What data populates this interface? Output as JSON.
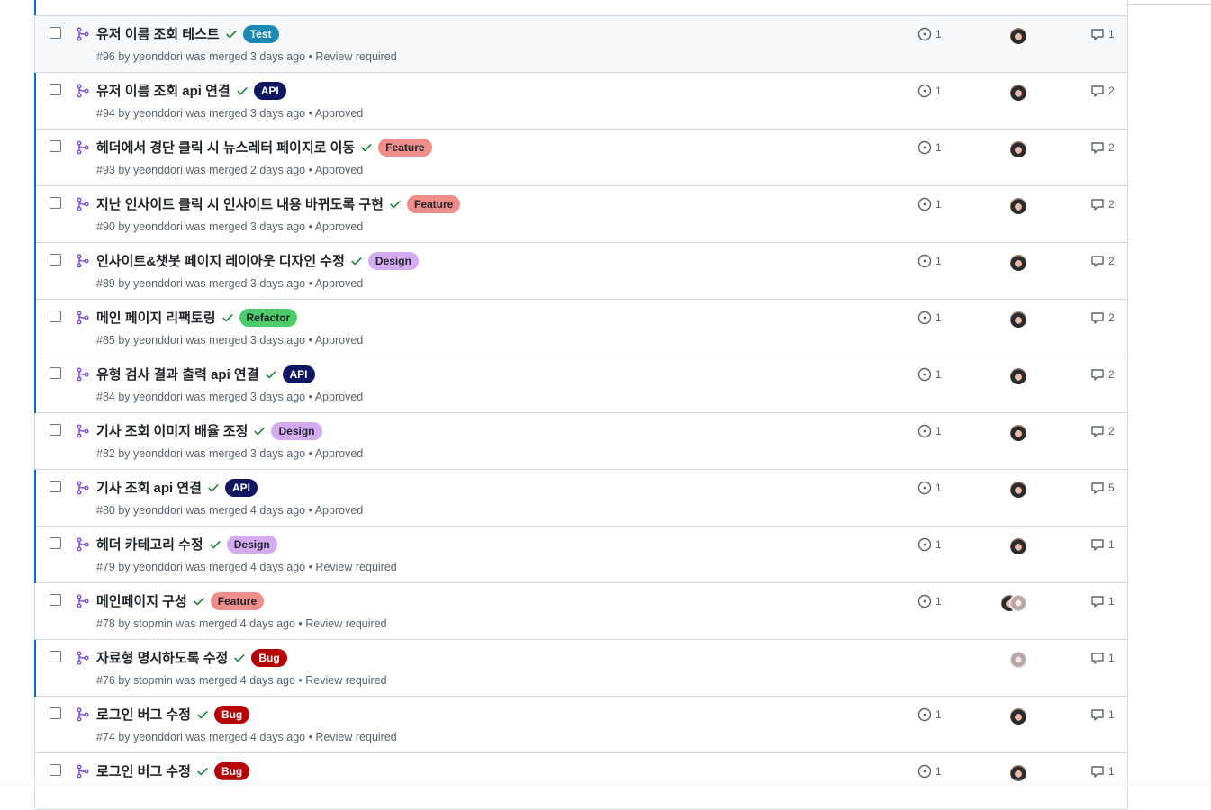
{
  "colors": {
    "merged_purple": "#8250df",
    "check_green": "#1a7f37",
    "unread_blue": "#0969da"
  },
  "icons": {
    "pr": "git-merge-icon",
    "status": "check-icon",
    "linked_issue": "issue-opened-icon",
    "comment": "comment-icon"
  },
  "pull_requests": [
    {
      "title": "유저 이름 조회 테스트",
      "label": "Test",
      "label_bg": "#1b8ab3",
      "label_fg": "#ffffff",
      "meta": "#96 by yeonddori was merged 3 days ago • Review required",
      "issues": "1",
      "comments": "1",
      "avatars": [
        "dark"
      ],
      "hover": true,
      "unread": false
    },
    {
      "title": "유저 이름 조회 api 연결",
      "label": "API",
      "label_bg": "#0e1561",
      "label_fg": "#ffffff",
      "meta": "#94 by yeonddori was merged 3 days ago • Approved",
      "issues": "1",
      "comments": "2",
      "avatars": [
        "dark"
      ],
      "hover": false,
      "unread": true
    },
    {
      "title": "헤더에서 경단 클릭 시 뉴스레터 페이지로 이동",
      "label": "Feature",
      "label_bg": "#ee8d8a",
      "label_fg": "#1f2328",
      "meta": "#93 by yeonddori was merged 2 days ago • Approved",
      "issues": "1",
      "comments": "2",
      "avatars": [
        "dark"
      ],
      "hover": false,
      "unread": true
    },
    {
      "title": "지난 인사이트 클릭 시 인사이트 내용 바뀌도록 구현",
      "label": "Feature",
      "label_bg": "#ee8d8a",
      "label_fg": "#1f2328",
      "meta": "#90 by yeonddori was merged 3 days ago • Approved",
      "issues": "1",
      "comments": "2",
      "avatars": [
        "dark"
      ],
      "hover": false,
      "unread": true
    },
    {
      "title": "인사이트&챗봇 페이지 레이아웃 디자인 수정",
      "label": "Design",
      "label_bg": "#d4aaf0",
      "label_fg": "#1f2328",
      "meta": "#89 by yeonddori was merged 3 days ago • Approved",
      "issues": "1",
      "comments": "2",
      "avatars": [
        "dark"
      ],
      "hover": false,
      "unread": true
    },
    {
      "title": "메인 페이지 리팩토링",
      "label": "Refactor",
      "label_bg": "#4ccb6b",
      "label_fg": "#1f2328",
      "meta": "#85 by yeonddori was merged 3 days ago • Approved",
      "issues": "1",
      "comments": "2",
      "avatars": [
        "dark"
      ],
      "hover": false,
      "unread": true
    },
    {
      "title": "유형 검사 결과 출력 api 연결",
      "label": "API",
      "label_bg": "#0e1561",
      "label_fg": "#ffffff",
      "meta": "#84 by yeonddori was merged 3 days ago • Approved",
      "issues": "1",
      "comments": "2",
      "avatars": [
        "dark"
      ],
      "hover": false,
      "unread": true
    },
    {
      "title": "기사 조회 이미지 배율 조정",
      "label": "Design",
      "label_bg": "#d4aaf0",
      "label_fg": "#1f2328",
      "meta": "#82 by yeonddori was merged 3 days ago • Approved",
      "issues": "1",
      "comments": "2",
      "avatars": [
        "dark"
      ],
      "hover": false,
      "unread": false
    },
    {
      "title": "기사 조회 api 연결",
      "label": "API",
      "label_bg": "#0e1561",
      "label_fg": "#ffffff",
      "meta": "#80 by yeonddori was merged 4 days ago • Approved",
      "issues": "1",
      "comments": "5",
      "avatars": [
        "dark"
      ],
      "hover": false,
      "unread": true
    },
    {
      "title": "헤더 카테고리 수정",
      "label": "Design",
      "label_bg": "#d4aaf0",
      "label_fg": "#1f2328",
      "meta": "#79 by yeonddori was merged 4 days ago • Review required",
      "issues": "1",
      "comments": "1",
      "avatars": [
        "dark"
      ],
      "hover": false,
      "unread": true
    },
    {
      "title": "메인페이지 구성",
      "label": "Feature",
      "label_bg": "#ee8d8a",
      "label_fg": "#1f2328",
      "meta": "#78 by stopmin was merged 4 days ago • Review required",
      "issues": "1",
      "comments": "1",
      "avatars": [
        "dark",
        "gray"
      ],
      "hover": false,
      "unread": false
    },
    {
      "title": "자료형 명시하도록 수정",
      "label": "Bug",
      "label_bg": "#b60205",
      "label_fg": "#ffffff",
      "meta": "#76 by stopmin was merged 4 days ago • Review required",
      "issues": "",
      "comments": "1",
      "avatars": [
        "gray"
      ],
      "hover": false,
      "unread": true
    },
    {
      "title": "로그인 버그 수정",
      "label": "Bug",
      "label_bg": "#b60205",
      "label_fg": "#ffffff",
      "meta": "#74 by yeonddori was merged 4 days ago • Review required",
      "issues": "1",
      "comments": "1",
      "avatars": [
        "dark"
      ],
      "hover": false,
      "unread": false
    },
    {
      "title": "로그인 버그 수정",
      "label": "Bug",
      "label_bg": "#b60205",
      "label_fg": "#ffffff",
      "meta": "",
      "issues": "1",
      "comments": "1",
      "avatars": [
        "dark"
      ],
      "hover": false,
      "unread": false
    }
  ]
}
